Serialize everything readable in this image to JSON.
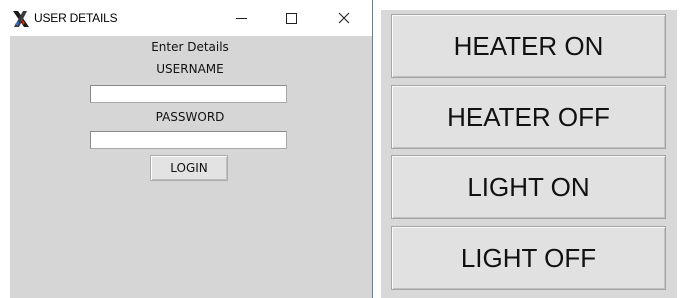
{
  "login_window": {
    "title": "USER DETAILS",
    "icon": "tk-feather-icon",
    "controls": {
      "minimize": "minimize-icon",
      "maximize": "maximize-icon",
      "close": "close-icon"
    },
    "heading": "Enter Details",
    "username_label": "USERNAME",
    "username_value": "",
    "password_label": "PASSWORD",
    "password_value": "",
    "login_button": "LOGIN"
  },
  "control_window": {
    "buttons": [
      {
        "label": "HEATER ON"
      },
      {
        "label": "HEATER OFF"
      },
      {
        "label": "LIGHT ON"
      },
      {
        "label": "LIGHT OFF"
      }
    ]
  },
  "colors": {
    "window_background": "#d6d6d6",
    "button_face": "#e1e1e1"
  }
}
